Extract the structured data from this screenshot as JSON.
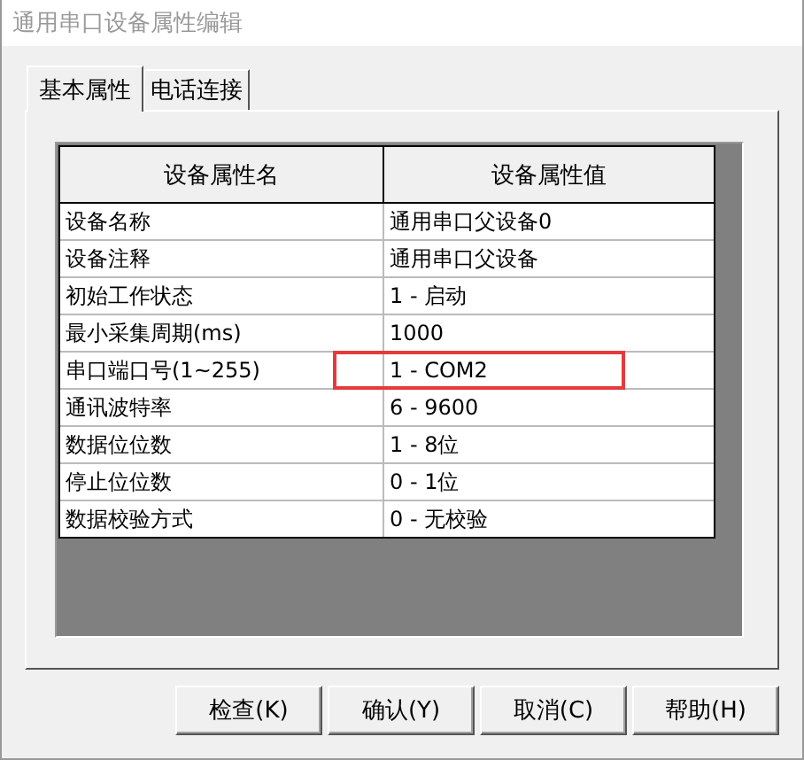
{
  "window": {
    "title": "通用串口设备属性编辑"
  },
  "tabs": [
    {
      "label": "基本属性",
      "selected": true
    },
    {
      "label": "电话连接",
      "selected": false
    }
  ],
  "table": {
    "columns": [
      "设备属性名",
      "设备属性值"
    ],
    "rows": [
      {
        "name": "设备名称",
        "value": "通用串口父设备0",
        "highlighted": false
      },
      {
        "name": "设备注释",
        "value": "通用串口父设备",
        "highlighted": false
      },
      {
        "name": "初始工作状态",
        "value": "1 - 启动",
        "highlighted": false
      },
      {
        "name": "最小采集周期(ms)",
        "value": "1000",
        "highlighted": false
      },
      {
        "name": "串口端口号(1~255)",
        "value": "1 - COM2",
        "highlighted": true
      },
      {
        "name": "通讯波特率",
        "value": "6 - 9600",
        "highlighted": false
      },
      {
        "name": "数据位位数",
        "value": "1 - 8位",
        "highlighted": false
      },
      {
        "name": "停止位位数",
        "value": "0 - 1位",
        "highlighted": false
      },
      {
        "name": "数据校验方式",
        "value": "0 - 无校验",
        "highlighted": false
      }
    ]
  },
  "buttons": [
    "检查(K)",
    "确认(Y)",
    "取消(C)",
    "帮助(H)"
  ]
}
